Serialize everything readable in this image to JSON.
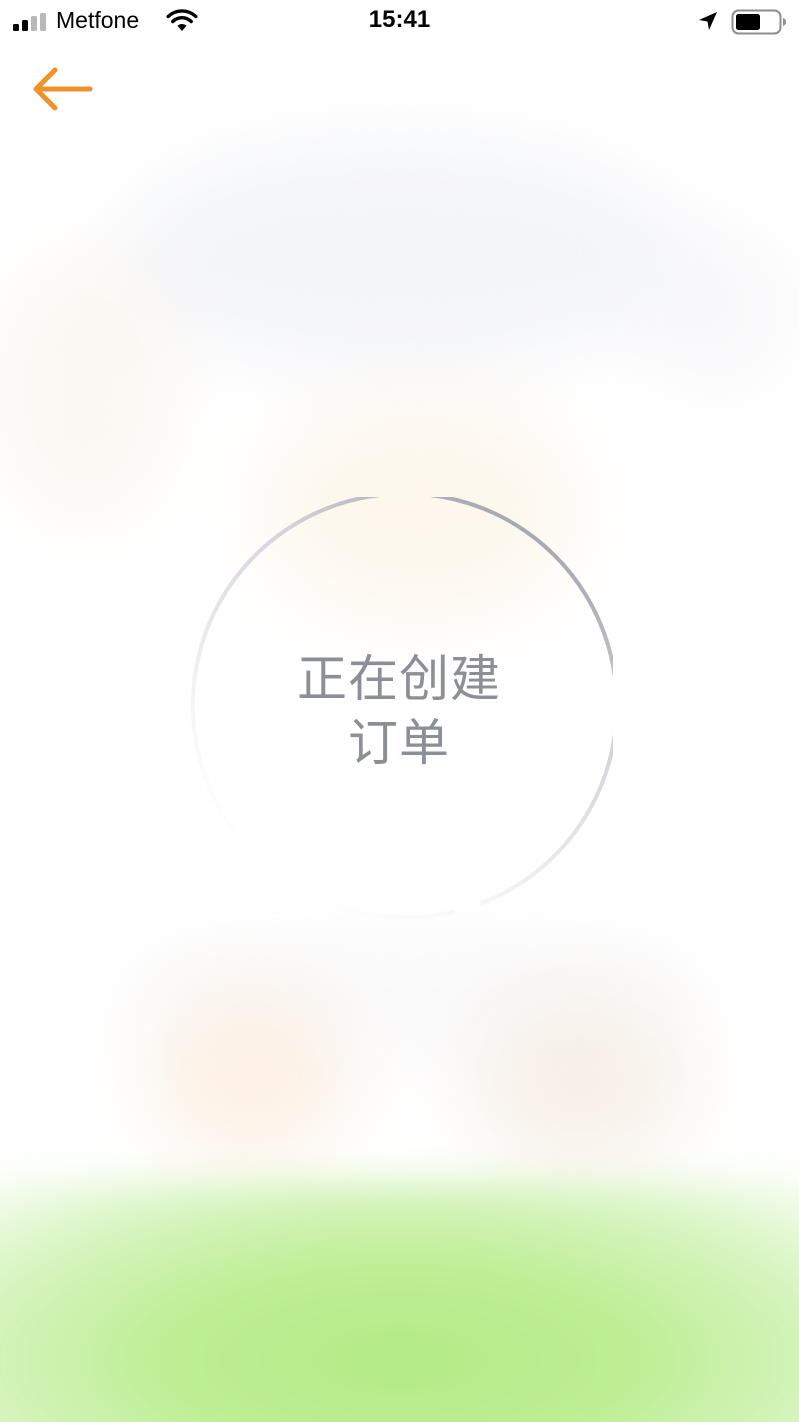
{
  "status_bar": {
    "carrier": "Metfone",
    "time": "15:41",
    "icons": [
      "signal-icon",
      "wifi-icon",
      "location-icon",
      "battery-icon"
    ]
  },
  "nav": {
    "back_icon": "arrow-left-icon",
    "back_color": "#f0922c"
  },
  "loader": {
    "line1": "正在创建",
    "line2": "订单",
    "ring_color": "#a4a6ae",
    "text_color": "#8d8f96"
  },
  "colors": {
    "accent": "#f0922c",
    "bottom_glow": "#b9ec8c"
  }
}
